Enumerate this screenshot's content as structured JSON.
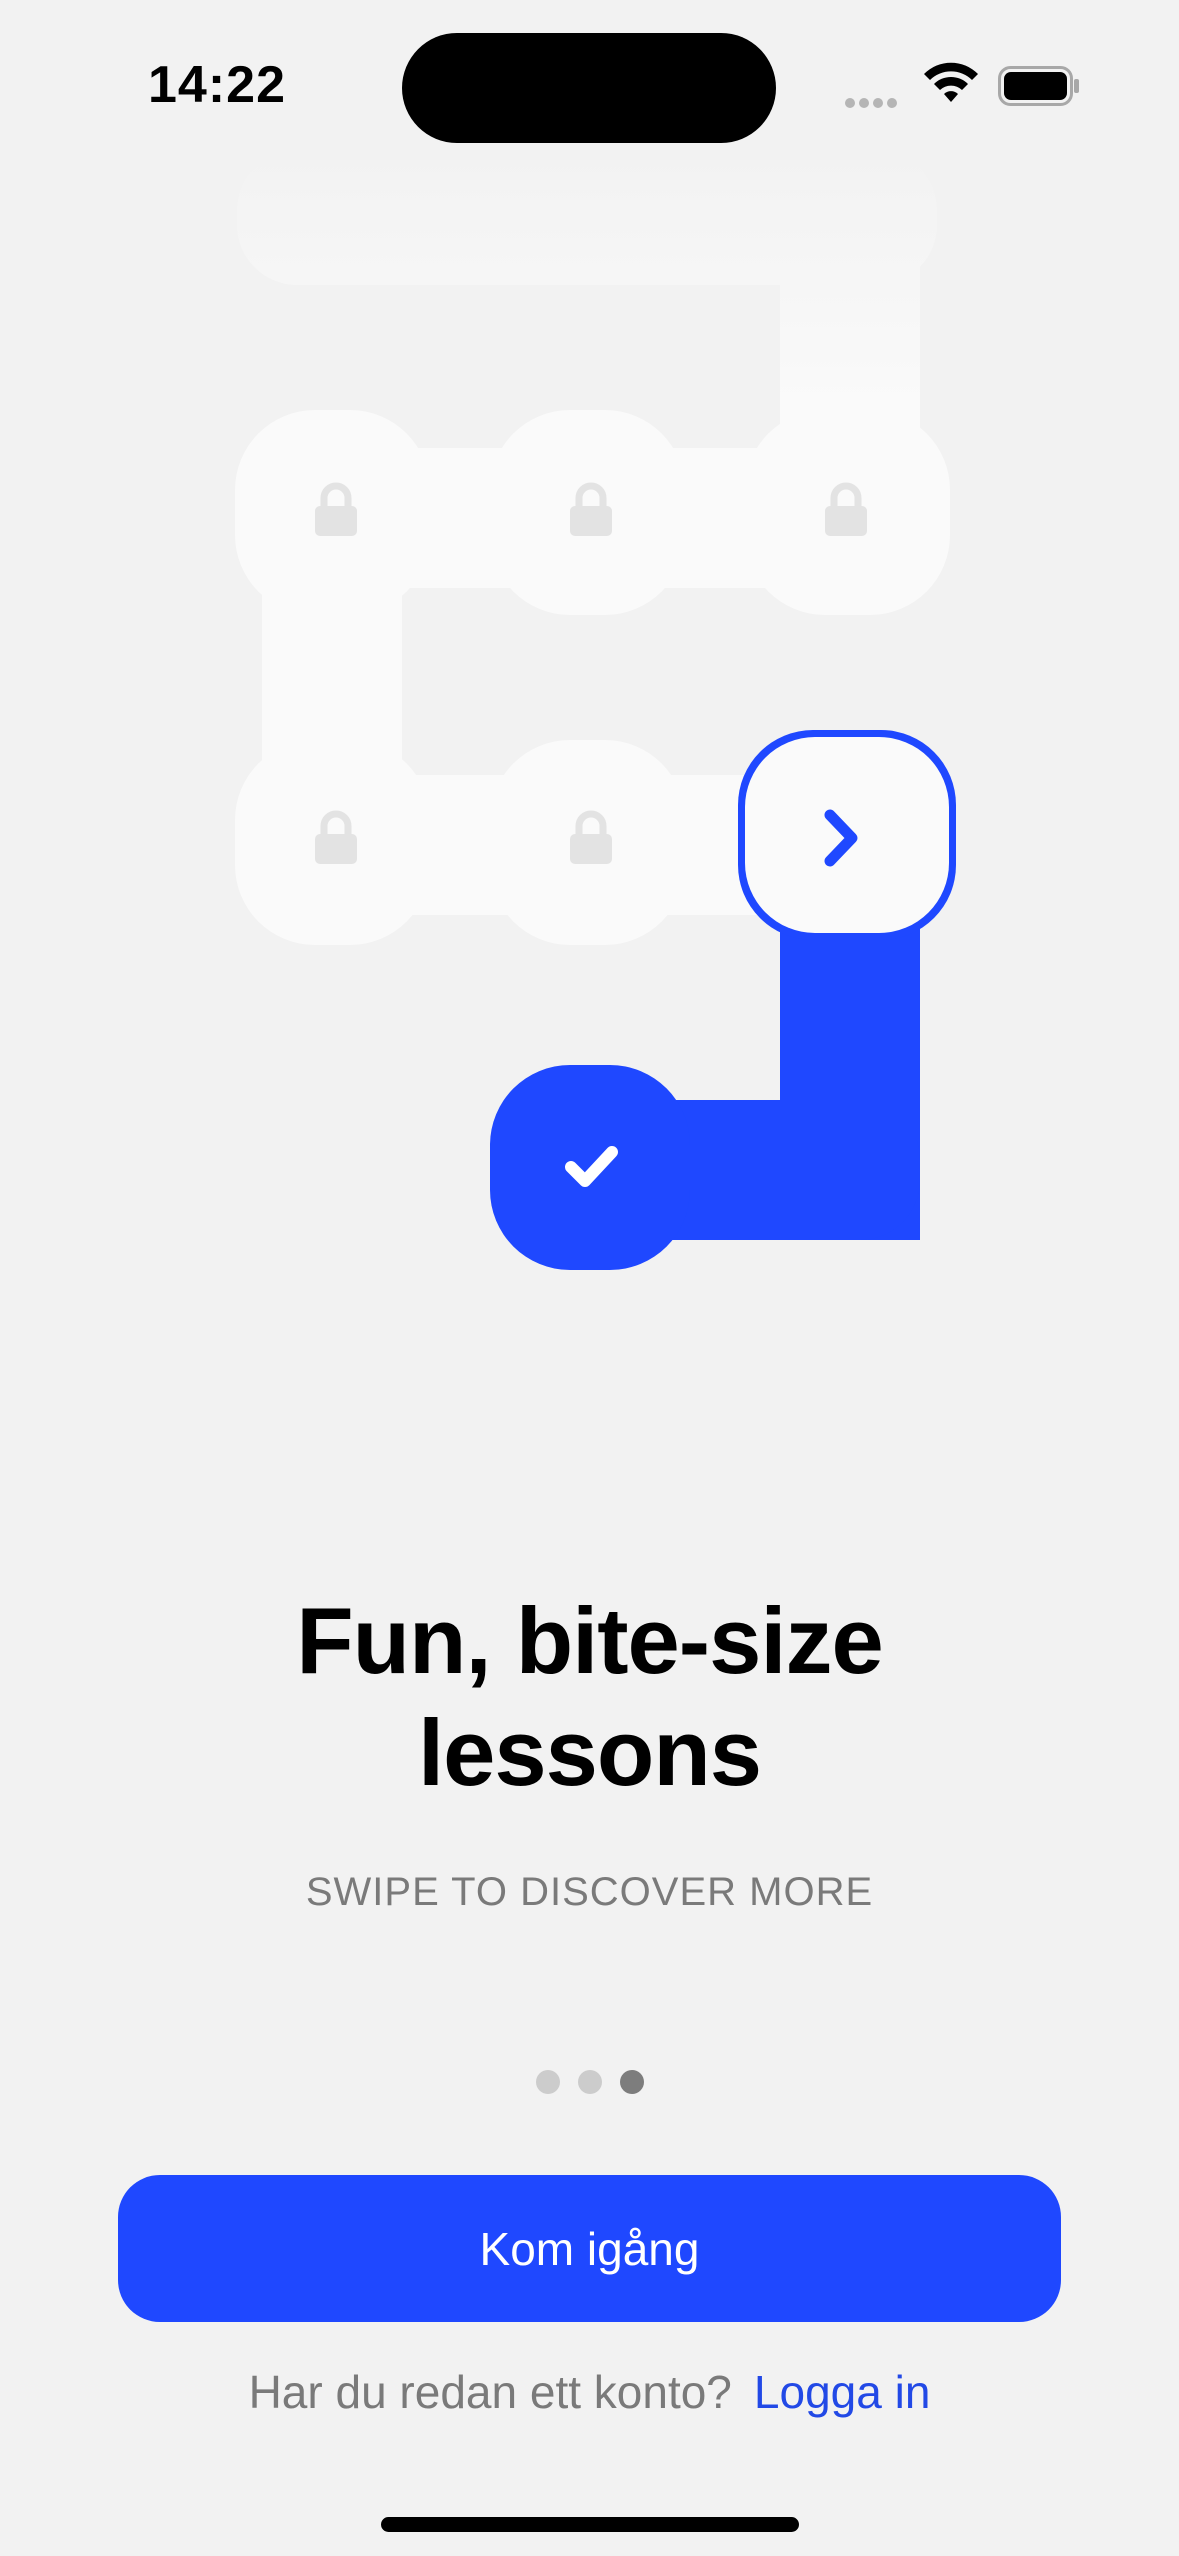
{
  "status_bar": {
    "time": "14:22",
    "icons": [
      "signal-icon",
      "wifi-icon",
      "battery-icon"
    ]
  },
  "lesson_path": {
    "nodes": [
      {
        "state": "locked",
        "icon": "lock-icon"
      },
      {
        "state": "locked",
        "icon": "lock-icon"
      },
      {
        "state": "locked",
        "icon": "lock-icon"
      },
      {
        "state": "locked",
        "icon": "lock-icon"
      },
      {
        "state": "locked",
        "icon": "lock-icon"
      },
      {
        "state": "current",
        "icon": "chevron-right-icon"
      },
      {
        "state": "completed",
        "icon": "checkmark-icon"
      }
    ],
    "colors": {
      "accent": "#1f48ff",
      "locked_tile": "#fafafa",
      "lock_glyph": "#e3e3e3"
    }
  },
  "onboarding": {
    "title": "Fun, bite-size lessons",
    "subtitle": "SWIPE TO DISCOVER MORE",
    "page_index": 3,
    "page_count": 3
  },
  "actions": {
    "primary_label": "Kom igång",
    "login_prompt": "Har du redan ett konto?",
    "login_link": "Logga in"
  }
}
